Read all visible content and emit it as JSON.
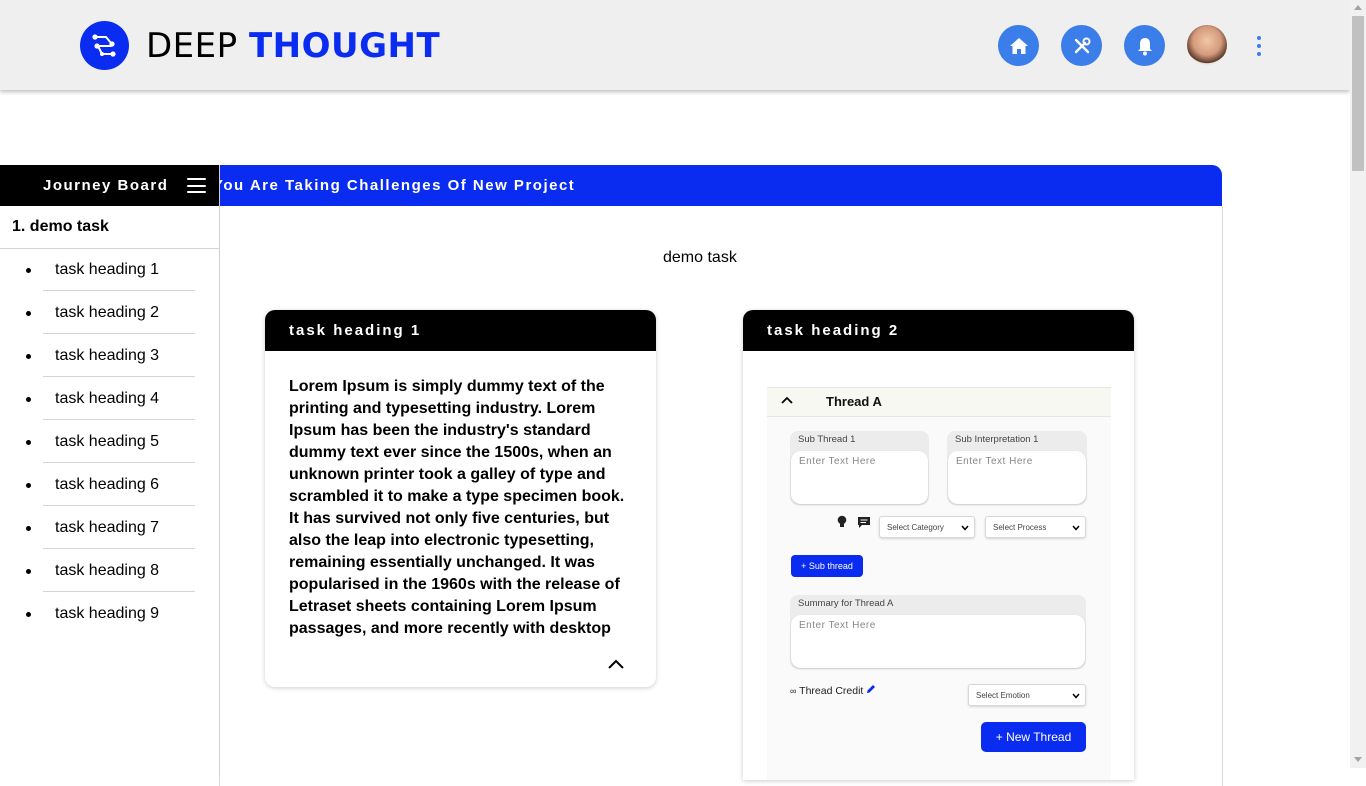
{
  "header": {
    "brand_first": "DEEP ",
    "brand_second": "THOUGHT",
    "colors": {
      "brand_blue": "#0a2cf0",
      "nav_blue": "#3b7de9"
    },
    "nav_icons": [
      "home-icon",
      "tools-icon",
      "bell-icon"
    ]
  },
  "banner": {
    "text": "You Are Taking Challenges Of New Project"
  },
  "sidebar": {
    "title": "Journey Board",
    "task": "1. demo task",
    "items": [
      {
        "label": "task heading 1"
      },
      {
        "label": "task heading 2"
      },
      {
        "label": "task heading 3"
      },
      {
        "label": "task heading 4"
      },
      {
        "label": "task heading 5"
      },
      {
        "label": "task heading 6"
      },
      {
        "label": "task heading 7"
      },
      {
        "label": "task heading 8"
      },
      {
        "label": "task heading 9"
      }
    ]
  },
  "main": {
    "title": "demo task",
    "card1": {
      "heading": "task heading 1",
      "body": "Lorem Ipsum is simply dummy text of the printing and typesetting industry. Lorem Ipsum has been the industry's standard dummy text ever since the 1500s, when an unknown printer took a galley of type and scrambled it to make a type specimen book. It has survived not only five centuries, but also the leap into electronic typesetting, remaining essentially unchanged. It was popularised in the 1960s with the release of Letraset sheets containing Lorem Ipsum passages, and more recently with desktop"
    },
    "card2": {
      "heading": "task heading 2",
      "thread_title": "Thread A",
      "sub_thread_label": "Sub Thread 1",
      "sub_interp_label": "Sub Interpretation 1",
      "placeholder": "Enter Text Here",
      "select_category": "Select Category",
      "select_process": "Select Process",
      "sub_thread_button": "+ Sub thread",
      "summary_label": "Summary for Thread A",
      "thread_credit": "Thread Credit",
      "select_emotion": "Select Emotion",
      "new_thread_button": "+ New Thread"
    }
  }
}
